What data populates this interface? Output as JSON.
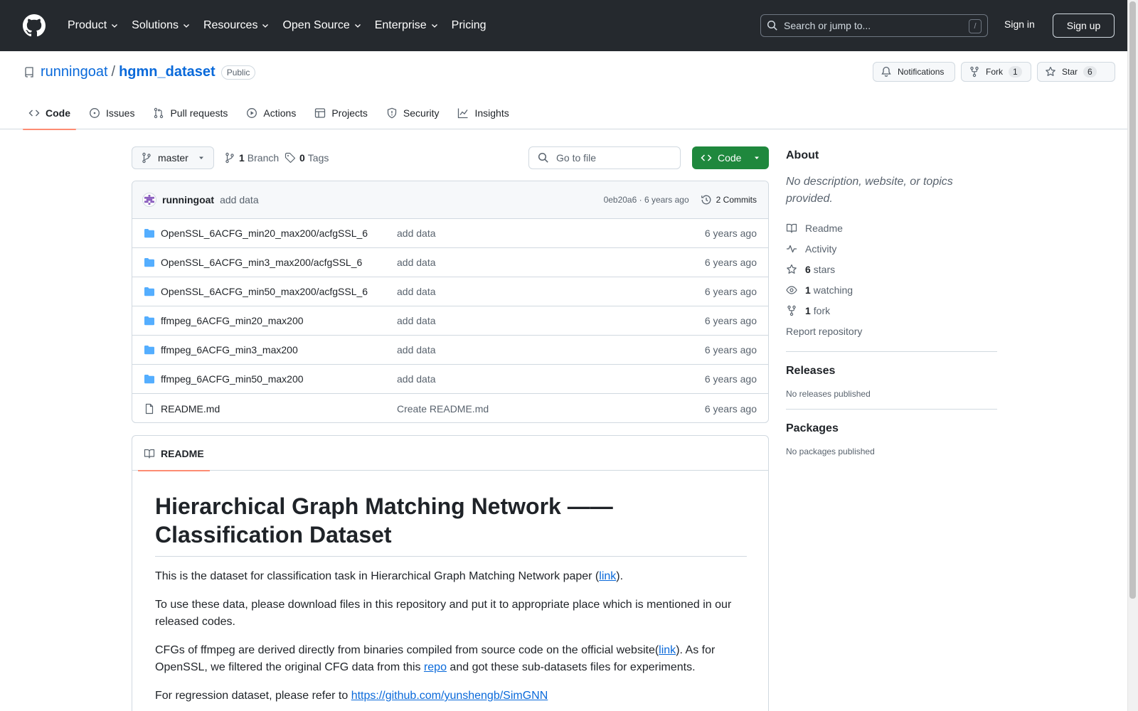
{
  "header": {
    "nav": [
      {
        "label": "Product",
        "dropdown": true
      },
      {
        "label": "Solutions",
        "dropdown": true
      },
      {
        "label": "Resources",
        "dropdown": true
      },
      {
        "label": "Open Source",
        "dropdown": true
      },
      {
        "label": "Enterprise",
        "dropdown": true
      },
      {
        "label": "Pricing",
        "dropdown": false
      }
    ],
    "search_placeholder": "Search or jump to...",
    "search_shortcut": "/",
    "sign_in": "Sign in",
    "sign_up": "Sign up"
  },
  "repo": {
    "owner": "runningoat",
    "separator": "/",
    "name": "hgmn_dataset",
    "visibility": "Public",
    "notifications_label": "Notifications",
    "fork_label": "Fork",
    "fork_count": "1",
    "star_label": "Star",
    "star_count": "6",
    "tabs": [
      "Code",
      "Issues",
      "Pull requests",
      "Actions",
      "Projects",
      "Security",
      "Insights"
    ]
  },
  "toolbar": {
    "branch": "master",
    "branch_count": "1",
    "branch_label": "Branch",
    "tag_count": "0",
    "tag_label": "Tags",
    "goto_placeholder": "Go to file",
    "code_label": "Code"
  },
  "commit": {
    "author": "runningoat",
    "message": "add data",
    "meta": "0eb20a6 · 6 years ago",
    "commits_label": "2 Commits"
  },
  "files": [
    {
      "name": "OpenSSL_6ACFG_min20_max200/acfgSSL_6",
      "type": "dir",
      "message": "add data",
      "age": "6 years ago"
    },
    {
      "name": "OpenSSL_6ACFG_min3_max200/acfgSSL_6",
      "type": "dir",
      "message": "add data",
      "age": "6 years ago"
    },
    {
      "name": "OpenSSL_6ACFG_min50_max200/acfgSSL_6",
      "type": "dir",
      "message": "add data",
      "age": "6 years ago"
    },
    {
      "name": "ffmpeg_6ACFG_min20_max200",
      "type": "dir",
      "message": "add data",
      "age": "6 years ago"
    },
    {
      "name": "ffmpeg_6ACFG_min3_max200",
      "type": "dir",
      "message": "add data",
      "age": "6 years ago"
    },
    {
      "name": "ffmpeg_6ACFG_min50_max200",
      "type": "dir",
      "message": "add data",
      "age": "6 years ago"
    },
    {
      "name": "README.md",
      "type": "file",
      "message": "Create README.md",
      "age": "6 years ago"
    }
  ],
  "readme": {
    "tab_label": "README",
    "title": "Hierarchical Graph Matching Network —— Classification Dataset",
    "p1_text": "This is the dataset for classification task in Hierarchical Graph Matching Network paper (",
    "p1_link": "link",
    "p1_end": ").",
    "p2": "To use these data, please download files in this repository and put it to appropriate place which is mentioned in our released codes.",
    "p3_text": "CFGs of ffmpeg are derived directly from binaries compiled from source code on the official website(",
    "p3_link": "link",
    "p3_mid": "). As for OpenSSL, we filtered the original CFG data from this ",
    "p3_link2": "repo",
    "p3_end": " and got these sub-datasets files for experiments.",
    "p4_text": "For regression dataset, please refer to ",
    "p4_link": "https://github.com/yunshengb/SimGNN"
  },
  "sidebar": {
    "about_title": "About",
    "description": "No description, website, or topics provided.",
    "readme": "Readme",
    "activity": "Activity",
    "stars_count": "6",
    "stars_label": "stars",
    "watching_count": "1",
    "watching_label": "watching",
    "forks_count": "1",
    "forks_label": "fork",
    "report": "Report repository",
    "releases_title": "Releases",
    "releases_text": "No releases published",
    "packages_title": "Packages",
    "packages_text": "No packages published"
  },
  "colors": {
    "header_bg": "#25292e",
    "link": "#0969da",
    "code_button": "#1f883d",
    "active_tab": "#fd8c73",
    "folder": "#54aeff"
  }
}
